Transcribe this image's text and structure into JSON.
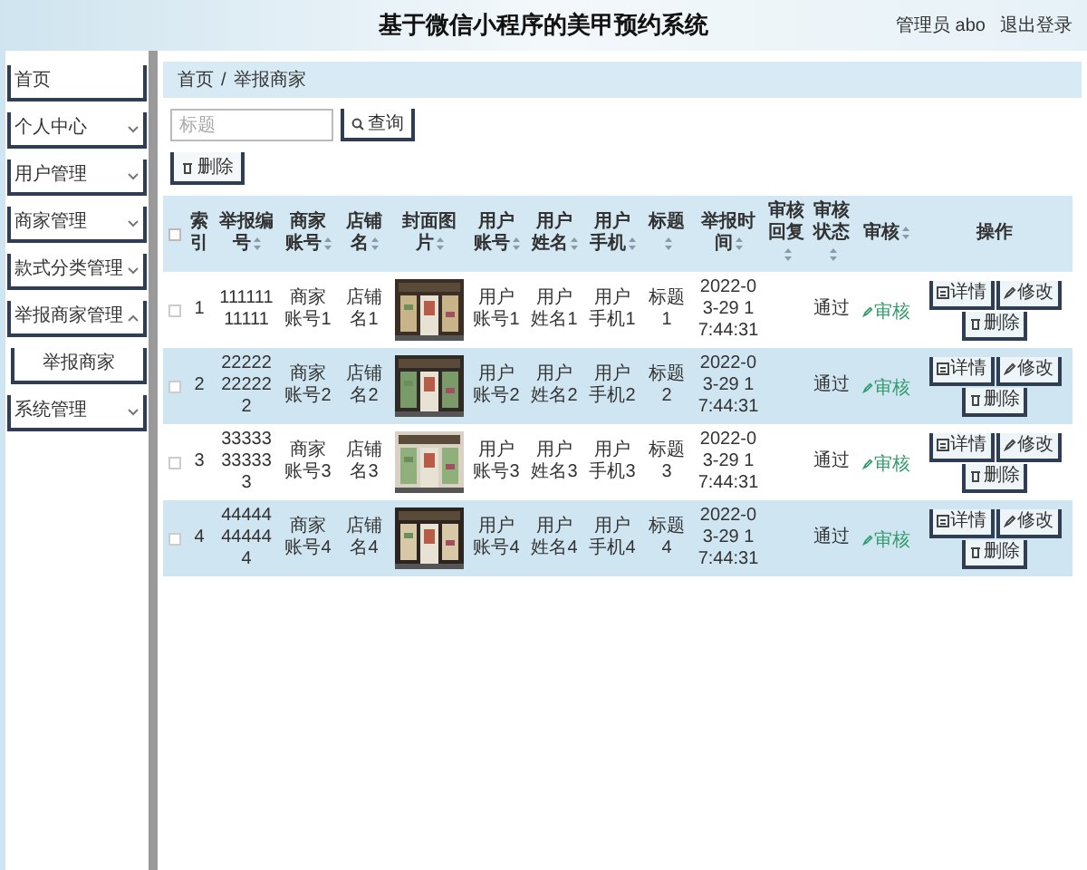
{
  "header": {
    "title": "基于微信小程序的美甲预约系统",
    "user": "管理员 abo",
    "logout": "退出登录"
  },
  "sidebar": {
    "items": [
      {
        "label": "首页",
        "kind": "link"
      },
      {
        "label": "个人中心",
        "kind": "menu",
        "expanded": false
      },
      {
        "label": "用户管理",
        "kind": "menu",
        "expanded": false
      },
      {
        "label": "商家管理",
        "kind": "menu",
        "expanded": false
      },
      {
        "label": "款式分类管理",
        "kind": "menu",
        "expanded": false
      },
      {
        "label": "举报商家管理",
        "kind": "menu",
        "expanded": true,
        "children": [
          {
            "label": "举报商家"
          }
        ]
      },
      {
        "label": "系统管理",
        "kind": "menu",
        "expanded": false
      }
    ]
  },
  "breadcrumb": {
    "items": [
      "首页",
      "举报商家"
    ],
    "separator": "/"
  },
  "search": {
    "placeholder": "标题",
    "button": "查询"
  },
  "delete_button": "删除",
  "table": {
    "select_all": {
      "checked": false
    },
    "columns": [
      {
        "label": "索引",
        "sortable": false
      },
      {
        "label": "举报编号",
        "sortable": true
      },
      {
        "label": "商家账号",
        "sortable": true
      },
      {
        "label": "店铺名",
        "sortable": true
      },
      {
        "label": "封面图片",
        "sortable": true
      },
      {
        "label": "用户账号",
        "sortable": true
      },
      {
        "label": "用户姓名",
        "sortable": true
      },
      {
        "label": "用户手机",
        "sortable": true
      },
      {
        "label": "标题",
        "sortable": true
      },
      {
        "label": "举报时间",
        "sortable": true
      },
      {
        "label": "审核回复",
        "sortable": true
      },
      {
        "label": "审核状态",
        "sortable": true
      },
      {
        "label": "审核",
        "sortable": true
      },
      {
        "label": "操作",
        "sortable": false
      }
    ],
    "rows": [
      {
        "checked": false,
        "index": "1",
        "report_no": "11111111111",
        "merchant": "商家账号1",
        "shop": "店铺名1",
        "cover": {
          "kind": "picture"
        },
        "user_account": "用户账号1",
        "user_name": "用户姓名1",
        "user_phone": "用户手机1",
        "title": "标题1",
        "time": "2022-03-29 17:44:31",
        "status": "通过",
        "review": "审核",
        "actions": [
          "详情",
          "修改",
          "删除"
        ]
      },
      {
        "checked": false,
        "index": "2",
        "report_no": "22222222222",
        "merchant": "商家账号2",
        "shop": "店铺名2",
        "cover": {
          "kind": "picture"
        },
        "user_account": "用户账号2",
        "user_name": "用户姓名2",
        "user_phone": "用户手机2",
        "title": "标题2",
        "time": "2022-03-29 17:44:31",
        "status": "通过",
        "review": "审核",
        "actions": [
          "详情",
          "修改",
          "删除"
        ]
      },
      {
        "checked": false,
        "index": "3",
        "report_no": "33333333333",
        "merchant": "商家账号3",
        "shop": "店铺名3",
        "cover": {
          "kind": "picture"
        },
        "user_account": "用户账号3",
        "user_name": "用户姓名3",
        "user_phone": "用户手机3",
        "title": "标题3",
        "time": "2022-03-29 17:44:31",
        "status": "通过",
        "review": "审核",
        "actions": [
          "详情",
          "修改",
          "删除"
        ]
      },
      {
        "checked": false,
        "index": "4",
        "report_no": "44444444444",
        "merchant": "商家账号4",
        "shop": "店铺名4",
        "cover": {
          "kind": "picture"
        },
        "user_account": "用户账号4",
        "user_name": "用户姓名4",
        "user_phone": "用户手机4",
        "title": "标题4",
        "time": "2022-03-29 17:44:31",
        "status": "通过",
        "review": "审核",
        "actions": [
          "详情",
          "修改",
          "删除"
        ]
      }
    ]
  }
}
